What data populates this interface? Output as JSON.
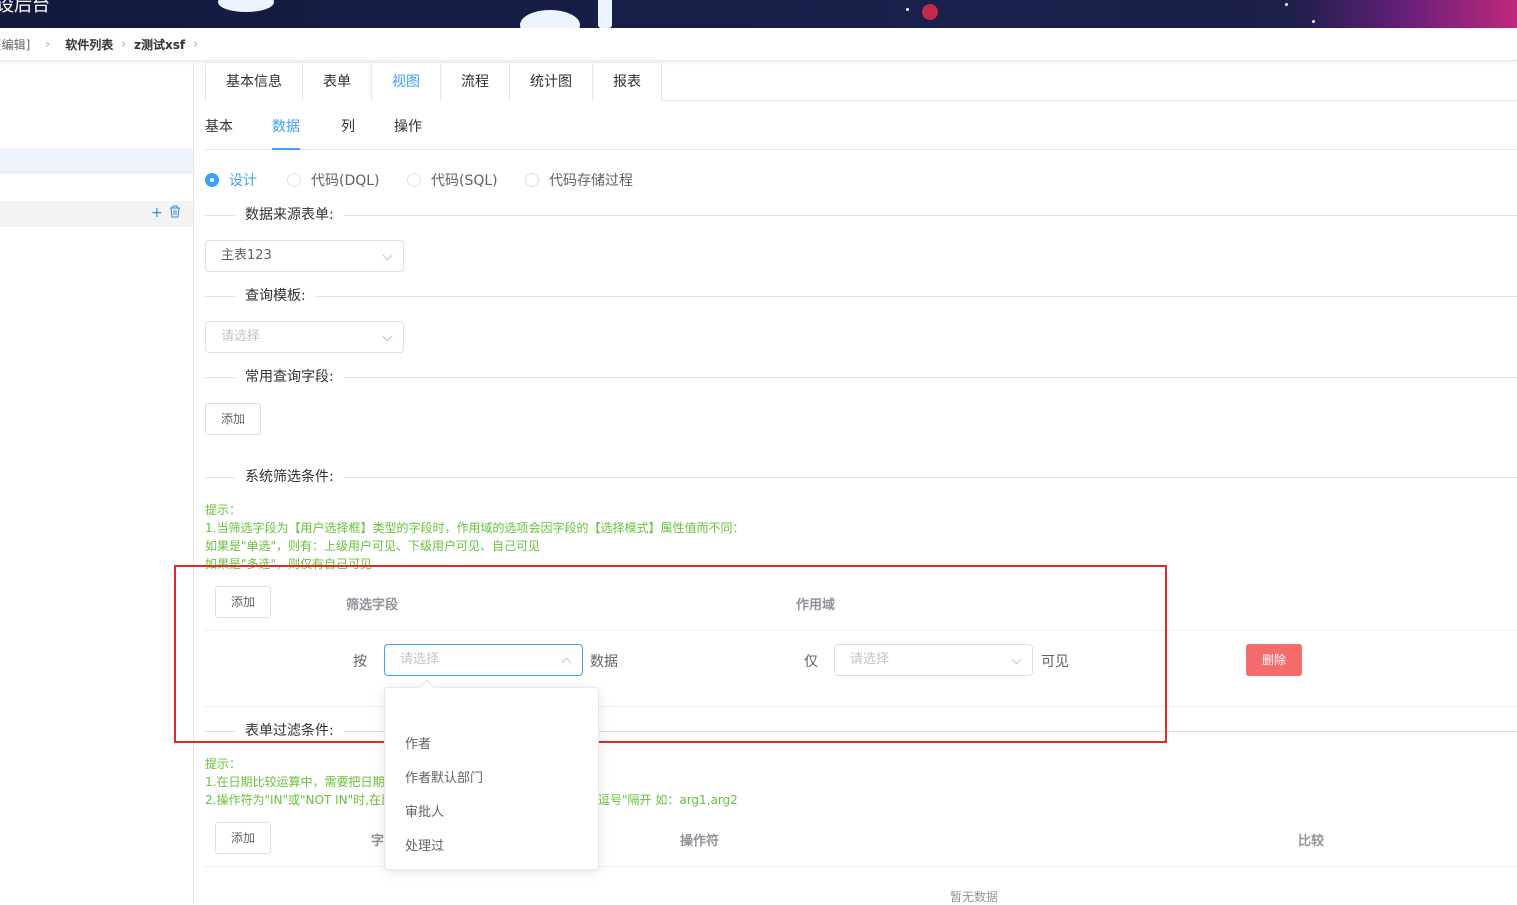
{
  "app": {
    "title": "设后台"
  },
  "breadcrumb": {
    "items": [
      "[编辑]",
      "软件列表",
      "z测试xsf"
    ]
  },
  "tabs": [
    {
      "label": "基本信息"
    },
    {
      "label": "表单"
    },
    {
      "label": "视图",
      "active": true
    },
    {
      "label": "流程"
    },
    {
      "label": "统计图"
    },
    {
      "label": "报表"
    }
  ],
  "subtabs": [
    {
      "label": "基本"
    },
    {
      "label": "数据",
      "active": true
    },
    {
      "label": "列"
    },
    {
      "label": "操作"
    }
  ],
  "radios": [
    {
      "label": "设计",
      "checked": true
    },
    {
      "label": "代码(DQL)"
    },
    {
      "label": "代码(SQL)"
    },
    {
      "label": "代码存储过程"
    }
  ],
  "sections": {
    "data_source": {
      "label": "数据来源表单:",
      "value": "主表123"
    },
    "query_template": {
      "label": "查询模板:",
      "placeholder": "请选择"
    },
    "common_fields": {
      "label": "常用查询字段:",
      "add": "添加"
    },
    "system_filter": {
      "label": "系统筛选条件:",
      "hint": [
        "提示：",
        "1.当筛选字段为【用户选择框】类型的字段时，作用域的选项会因字段的【选择模式】属性值而不同：",
        "如果是\"单选\"，则有：上级用户可见、下级用户可见、自己可见",
        "如果是\"多选\"，则仅有自己可见"
      ],
      "add": "添加",
      "col_field": "筛选字段",
      "col_scope": "作用域",
      "row": {
        "prefix": "按",
        "field_placeholder": "请选择",
        "middle": "数据",
        "scope_prefix": "仅",
        "scope_placeholder": "请选择",
        "suffix": "可见",
        "delete": "删除"
      }
    },
    "form_filter": {
      "label": "表单过滤条件:",
      "hint": [
        "提示：",
        "1.在日期比较运算中，需要把日期",
        "2.操作符为\"IN\"或\"NOT IN\"时,在比",
        "逗号\"隔开 如：arg1,arg2"
      ],
      "add": "添加",
      "col_field": "字",
      "col_operator": "操作符",
      "col_compare": "比较",
      "empty": "暂无数据"
    }
  },
  "dropdown": {
    "options": [
      "",
      "作者",
      "作者默认部门",
      "审批人",
      "处理过"
    ]
  },
  "colors": {
    "accent": "#409eff",
    "danger": "#f56c6c",
    "hint": "#67c23a",
    "highlight": "#e12b2b"
  }
}
